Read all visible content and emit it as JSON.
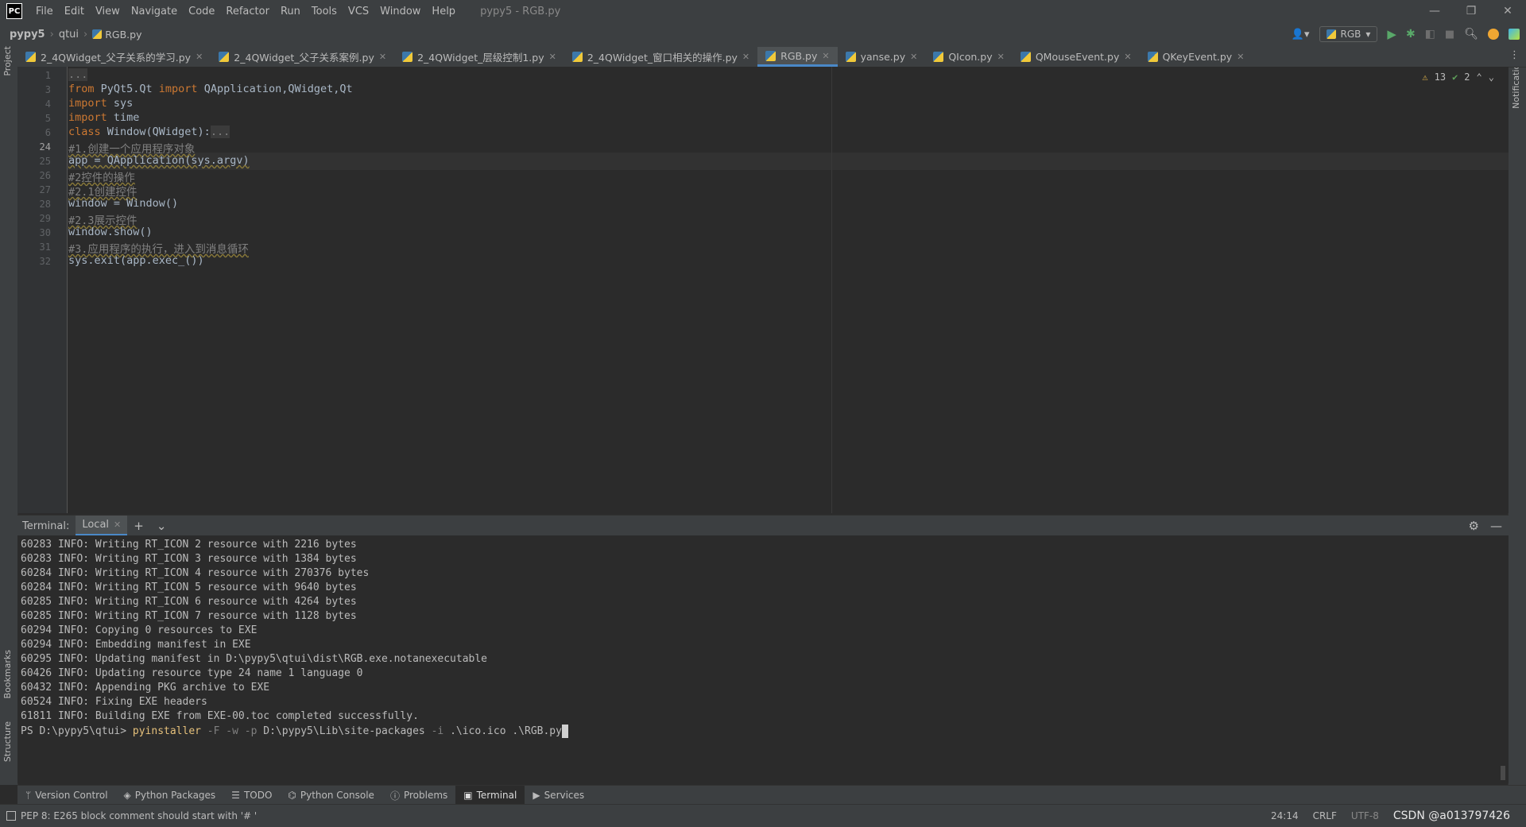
{
  "titlebar": {
    "logo": "PC",
    "menu": [
      "File",
      "Edit",
      "View",
      "Navigate",
      "Code",
      "Refactor",
      "Run",
      "Tools",
      "VCS",
      "Window",
      "Help"
    ],
    "window_title": "pypy5 - RGB.py",
    "minimize": "—",
    "restore": "❐",
    "close": "✕"
  },
  "navbar": {
    "project": "pypy5",
    "folder": "qtui",
    "file": "RGB.py",
    "run_config": "RGB"
  },
  "tabs": [
    {
      "label": "2_4QWidget_父子关系的学习.py"
    },
    {
      "label": "2_4QWidget_父子关系案例.py"
    },
    {
      "label": "2_4QWidget_层级控制1.py"
    },
    {
      "label": "2_4QWidget_窗口相关的操作.py"
    },
    {
      "label": "RGB.py"
    },
    {
      "label": "yanse.py"
    },
    {
      "label": "QIcon.py"
    },
    {
      "label": "QMouseEvent.py"
    },
    {
      "label": "QKeyEvent.py"
    }
  ],
  "side": {
    "project": "Project",
    "bookmarks": "Bookmarks",
    "structure": "Structure",
    "notifications": "Notifications"
  },
  "editor": {
    "line_numbers": [
      "1",
      "3",
      "4",
      "5",
      "6",
      "24",
      "25",
      "26",
      "27",
      "28",
      "29",
      "30",
      "31",
      "32"
    ],
    "inspections": {
      "warnings": "13",
      "ok": "2"
    },
    "code": {
      "l1": "...",
      "l3a": "from",
      "l3b": " PyQt5.Qt ",
      "l3c": "import",
      "l3d": " QApplication,QWidget,Qt",
      "l4a": "import",
      "l4b": " sys",
      "l5a": "import",
      "l5b": " time",
      "l6a": "class",
      "l6b": " Window(QWidget):",
      "l6c": "...",
      "l24": "#1.创建一个应用程序对象",
      "l25": "app = QApplication(sys.argv)",
      "l26": "#2控件的操作",
      "l27": "#2.1创建控件",
      "l28": "window = Window()",
      "l29": "#2.3展示控件",
      "l30": "window.show()",
      "l31": "#3.应用程序的执行，进入到消息循环",
      "l32": "sys.exit(app.exec_())"
    }
  },
  "terminal": {
    "label": "Terminal:",
    "tab": "Local",
    "lines": [
      "60283 INFO: Writing RT_ICON 2 resource with 2216 bytes",
      "60283 INFO: Writing RT_ICON 3 resource with 1384 bytes",
      "60284 INFO: Writing RT_ICON 4 resource with 270376 bytes",
      "60284 INFO: Writing RT_ICON 5 resource with 9640 bytes",
      "60285 INFO: Writing RT_ICON 6 resource with 4264 bytes",
      "60285 INFO: Writing RT_ICON 7 resource with 1128 bytes",
      "60294 INFO: Copying 0 resources to EXE",
      "60294 INFO: Embedding manifest in EXE",
      "60295 INFO: Updating manifest in D:\\pypy5\\qtui\\dist\\RGB.exe.notanexecutable",
      "60426 INFO: Updating resource type 24 name 1 language 0",
      "60432 INFO: Appending PKG archive to EXE",
      "60524 INFO: Fixing EXE headers",
      "61811 INFO: Building EXE from EXE-00.toc completed successfully."
    ],
    "prompt": "PS D:\\pypy5\\qtui> ",
    "cmd": "pyinstaller",
    "opt1": " -F -w -p ",
    "path": "D:\\pypy5\\Lib\\site-packages",
    "opt2": " -i ",
    "args": ".\\ico.ico .\\RGB.py"
  },
  "toolwindows": [
    "Version Control",
    "Python Packages",
    "TODO",
    "Python Console",
    "Problems",
    "Terminal",
    "Services"
  ],
  "status": {
    "message": "PEP 8: E265 block comment should start with '# '",
    "position": "24:14",
    "line_sep": "CRLF",
    "encoding": "UTF-8",
    "watermark": "CSDN @a013797426"
  }
}
